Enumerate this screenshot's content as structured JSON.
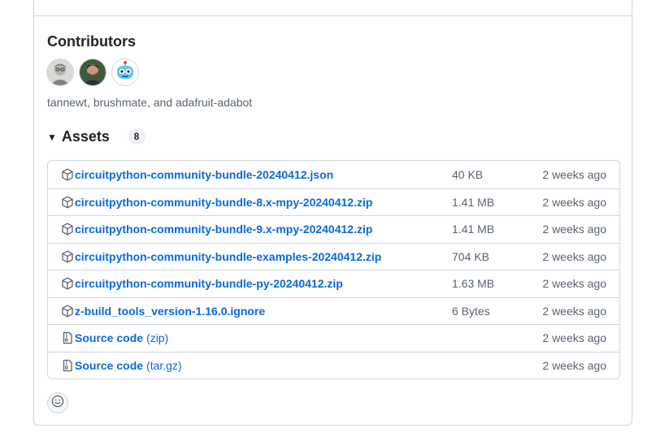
{
  "contributors": {
    "title": "Contributors",
    "names": "tannewt, brushmate, and adafruit-adabot",
    "avatars": [
      {
        "user": "tannewt",
        "icon": "avatar-tannewt"
      },
      {
        "user": "brushmate",
        "icon": "avatar-brushmate"
      },
      {
        "user": "adafruit-adabot",
        "icon": "avatar-adabot"
      }
    ]
  },
  "assets": {
    "title": "Assets",
    "count": "8",
    "items": [
      {
        "name": "circuitpython-community-bundle-20240412.json",
        "size": "40 KB",
        "date": "2 weeks ago",
        "icon": "package-icon"
      },
      {
        "name": "circuitpython-community-bundle-8.x-mpy-20240412.zip",
        "size": "1.41 MB",
        "date": "2 weeks ago",
        "icon": "package-icon"
      },
      {
        "name": "circuitpython-community-bundle-9.x-mpy-20240412.zip",
        "size": "1.41 MB",
        "date": "2 weeks ago",
        "icon": "package-icon"
      },
      {
        "name": "circuitpython-community-bundle-examples-20240412.zip",
        "size": "704 KB",
        "date": "2 weeks ago",
        "icon": "package-icon"
      },
      {
        "name": "circuitpython-community-bundle-py-20240412.zip",
        "size": "1.63 MB",
        "date": "2 weeks ago",
        "icon": "package-icon"
      },
      {
        "name": "z-build_tools_version-1.16.0.ignore",
        "size": "6 Bytes",
        "date": "2 weeks ago",
        "icon": "package-icon"
      },
      {
        "name": "Source code",
        "suffix": "(zip)",
        "size": "",
        "date": "2 weeks ago",
        "icon": "file-zip-icon"
      },
      {
        "name": "Source code",
        "suffix": "(tar.gz)",
        "size": "",
        "date": "2 weeks ago",
        "icon": "file-zip-icon"
      }
    ]
  },
  "reactions": {
    "icon": "smiley-icon"
  },
  "colors": {
    "link": "#0969da",
    "muted": "#59636e",
    "border": "#d0d7de",
    "text": "#1f2328"
  }
}
